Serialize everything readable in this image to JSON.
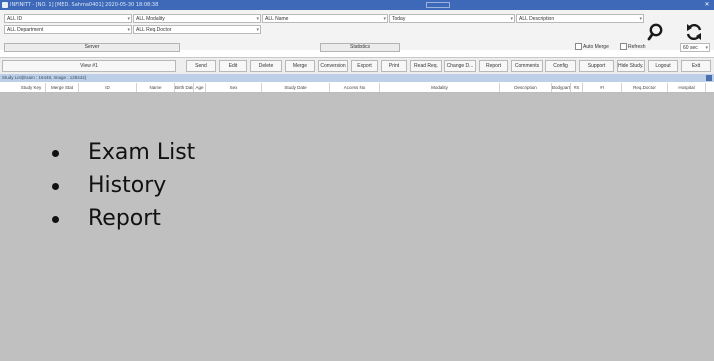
{
  "window": {
    "title": "INFINITT - [NO. 1] [MED. Sahma0401] 2020-05-30 18:08:38"
  },
  "filters": {
    "id": "ALL ID",
    "modality": "ALL Modality",
    "name": "ALL Name",
    "date": "Today",
    "description": "ALL Description",
    "department": "ALL Department",
    "req_doctor": "ALL Req.Doctor",
    "server_label": "Server",
    "statistics_label": "Statistics",
    "auto_merge_label": "Auto Merge",
    "refresh_label": "Refresh",
    "refresh_interval": "60 sec"
  },
  "toolbar": {
    "view_label": "View #1",
    "buttons": [
      "Send",
      "Edit",
      "Delete",
      "Merge",
      "Conversion",
      "Export",
      "Print",
      "Read Req.",
      "Change D...",
      "Report",
      "Comments",
      "Config",
      "Support",
      "Hide Study...",
      "Logout",
      "Exit"
    ]
  },
  "status": {
    "text": "Study List(Exam : 16448, Image : 128442)"
  },
  "columns": [
    "Study Key",
    "Merge Stat",
    "ID",
    "Name",
    "Birth Date",
    "Age",
    "Sex",
    "Study Date",
    "Access No",
    "Modality",
    "Description",
    "Bodypart",
    "#S",
    "#I",
    "Req.Doctor",
    "Hospital"
  ],
  "overlay": {
    "items": [
      "Exam List",
      "History",
      "Report"
    ]
  },
  "icons": {
    "search": "search-icon",
    "refresh": "refresh-icon"
  },
  "colors": {
    "titlebar": "#3d69b8",
    "status_bar": "#bccfe6",
    "grid_body": "#c0c0c0"
  }
}
